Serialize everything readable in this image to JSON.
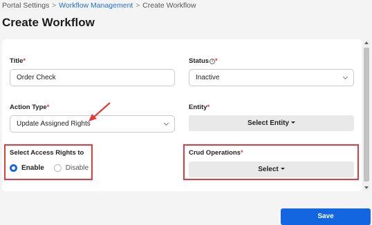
{
  "breadcrumb": {
    "items": [
      "Portal Settings",
      "Workflow Management",
      "Create Workflow"
    ]
  },
  "page": {
    "title": "Create Workflow"
  },
  "form": {
    "title": {
      "label": "Title",
      "required_mark": "*",
      "value": "Order Check"
    },
    "status": {
      "label": "Status",
      "required_mark": "*",
      "value": "Inactive",
      "info_icon": "info-icon"
    },
    "action_type": {
      "label": "Action Type",
      "required_mark": "*",
      "value": "Update Assigned Rights"
    },
    "entity": {
      "label": "Entity",
      "required_mark": "*",
      "button_label": "Select Entity"
    },
    "access_rights": {
      "label": "Select Access Rights to",
      "options": [
        "Enable",
        "Disable"
      ],
      "selected": "Enable"
    },
    "crud": {
      "label": "Crud Operations",
      "required_mark": "*",
      "button_label": "Select"
    }
  },
  "actions": {
    "save_label": "Save"
  },
  "colors": {
    "accent": "#1466e0",
    "required": "#e0393e",
    "annotation": "#e23a3a",
    "link": "#1f6fd0"
  }
}
